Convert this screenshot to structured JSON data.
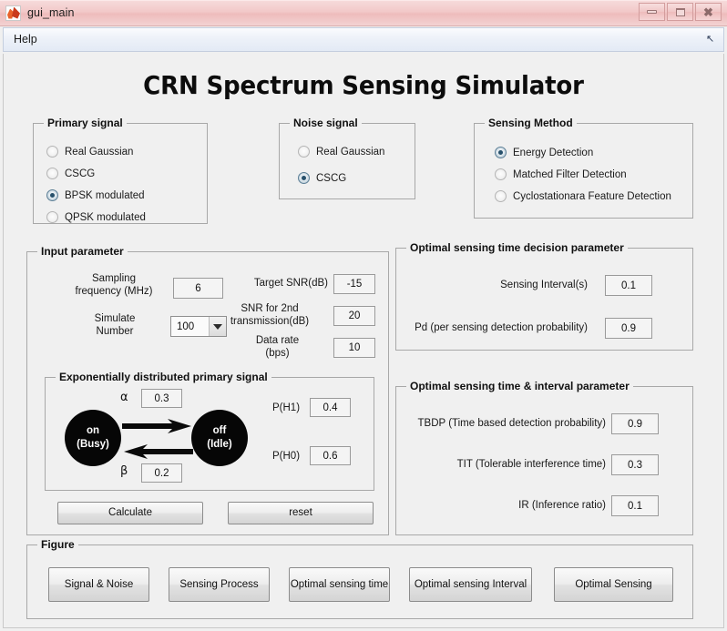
{
  "window": {
    "title": "gui_main",
    "icon": "matlab-membrane-icon",
    "buttons": {
      "minimize": "minimize-icon",
      "maximize": "maximize-icon",
      "close": "close-icon"
    }
  },
  "menubar": {
    "items": [
      "Help"
    ],
    "corner_glyph": "↖"
  },
  "app_title": "CRN Spectrum Sensing Simulator",
  "primary_signal": {
    "title": "Primary signal",
    "options": [
      {
        "label": "Real Gaussian",
        "selected": false
      },
      {
        "label": "CSCG",
        "selected": false
      },
      {
        "label": "BPSK modulated",
        "selected": true
      },
      {
        "label": "QPSK modulated",
        "selected": false
      }
    ]
  },
  "noise_signal": {
    "title": "Noise signal",
    "options": [
      {
        "label": "Real Gaussian",
        "selected": false
      },
      {
        "label": "CSCG",
        "selected": true
      }
    ]
  },
  "sensing_method": {
    "title": "Sensing Method",
    "options": [
      {
        "label": "Energy Detection",
        "selected": true
      },
      {
        "label": "Matched Filter Detection",
        "selected": false
      },
      {
        "label": "Cyclostationara Feature Detection",
        "selected": false
      }
    ]
  },
  "input_parameter": {
    "title": "Input parameter",
    "fields": [
      {
        "label": "Sampling\nfrequency (MHz)",
        "value": "6",
        "type": "edit"
      },
      {
        "label": "Simulate\nNumber",
        "value": "100",
        "type": "dropdown"
      },
      {
        "label": "Target SNR(dB)",
        "value": "-15",
        "type": "edit"
      },
      {
        "label": "SNR for 2nd\ntransmission(dB)",
        "value": "20",
        "type": "edit"
      },
      {
        "label": "Data rate\n(bps)",
        "value": "10",
        "type": "edit"
      }
    ]
  },
  "exponential_panel": {
    "title": "Exponentially distributed primary signal",
    "alpha_symbol": "α",
    "alpha_value": "0.3",
    "beta_symbol": "β",
    "beta_value": "0.2",
    "state_on": {
      "line1": "on",
      "line2": "(Busy)"
    },
    "state_off": {
      "line1": "off",
      "line2": "(Idle)"
    },
    "probabilities": [
      {
        "label": "P(H1)",
        "value": "0.4"
      },
      {
        "label": "P(H0)",
        "value": "0.6"
      }
    ]
  },
  "action_buttons": [
    {
      "label": "Calculate"
    },
    {
      "label": "reset"
    }
  ],
  "decision_parameter": {
    "title": "Optimal sensing time decision parameter",
    "fields": [
      {
        "label": "Sensing Interval(s)",
        "value": "0.1"
      },
      {
        "label": "Pd (per sensing detection probability)",
        "value": "0.9"
      }
    ]
  },
  "interval_parameter": {
    "title": "Optimal sensing time & interval parameter",
    "fields": [
      {
        "label": "TBDP (Time based detection probability)",
        "value": "0.9"
      },
      {
        "label": "TIT (Tolerable interference time)",
        "value": "0.3"
      },
      {
        "label": "IR (Inference ratio)",
        "value": "0.1"
      }
    ]
  },
  "figure_panel": {
    "title": "Figure",
    "buttons": [
      {
        "label": "Signal & Noise"
      },
      {
        "label": "Sensing Process"
      },
      {
        "label": "Optimal sensing time"
      },
      {
        "label": "Optimal sensing Interval"
      },
      {
        "label": "Optimal Sensing"
      }
    ]
  },
  "colors": {
    "panel_bg": "#f0f0f0",
    "titlebar": "#f2c9c9",
    "radio_accent": "#27506b",
    "state_circle": "#060606"
  }
}
